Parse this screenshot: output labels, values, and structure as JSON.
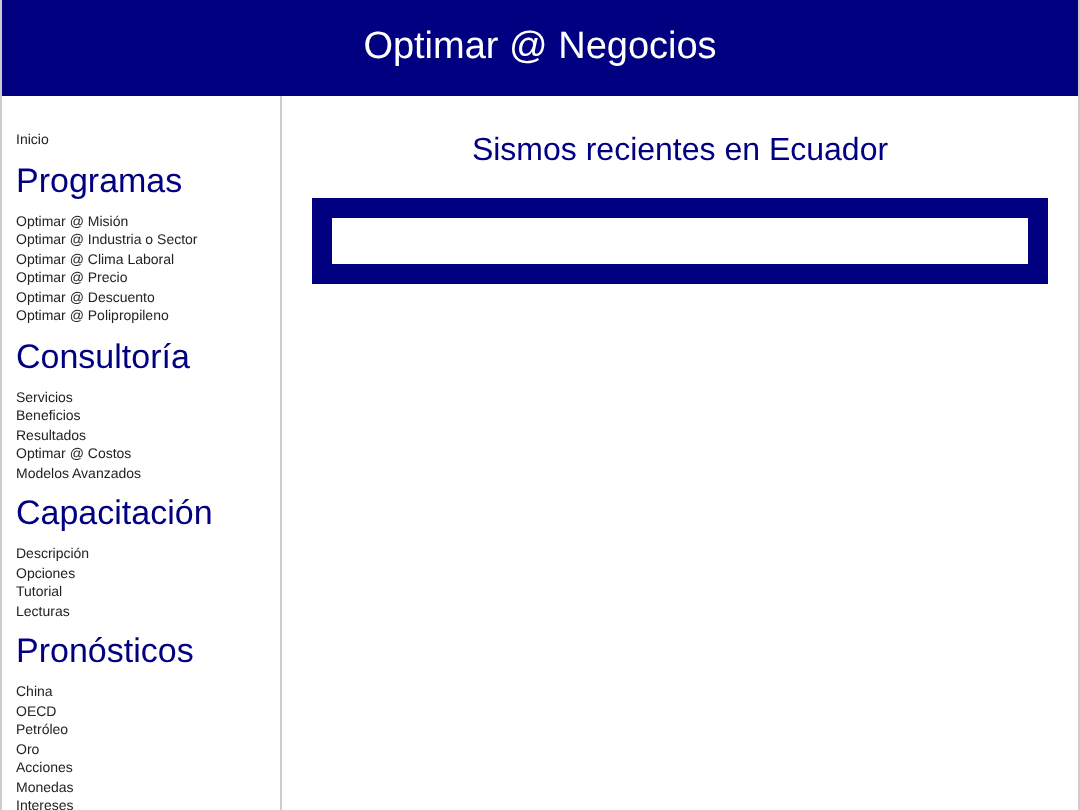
{
  "header": {
    "title": "Optimar @ Negocios"
  },
  "sidebar": {
    "top_links": [
      "Inicio"
    ],
    "sections": [
      {
        "heading": "Programas",
        "items": [
          "Optimar @ Misión",
          "Optimar @ Industria o Sector",
          "Optimar @ Clima Laboral",
          "Optimar @ Precio",
          "Optimar @ Descuento",
          "Optimar @ Polipropileno"
        ]
      },
      {
        "heading": "Consultoría",
        "items": [
          "Servicios",
          "Beneficios",
          "Resultados",
          "Optimar @ Costos",
          "Modelos Avanzados"
        ]
      },
      {
        "heading": "Capacitación",
        "items": [
          "Descripción",
          "Opciones",
          "Tutorial",
          "Lecturas"
        ]
      },
      {
        "heading": "Pronósticos",
        "items": [
          "China",
          "OECD",
          "Petróleo",
          "Oro",
          "Acciones",
          "Monedas",
          "Intereses"
        ]
      }
    ]
  },
  "main": {
    "title": "Sismos recientes en Ecuador"
  }
}
